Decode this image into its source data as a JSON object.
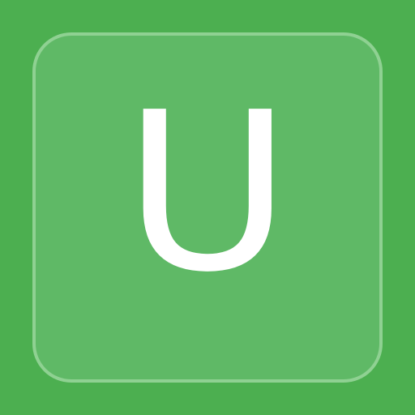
{
  "app_icon": {
    "letter": "U",
    "icon_name": "letter-u-icon",
    "background_color": "#4caf50",
    "tile_color": "#5fb966",
    "border_color": "#8fd192",
    "text_color": "#ffffff"
  }
}
